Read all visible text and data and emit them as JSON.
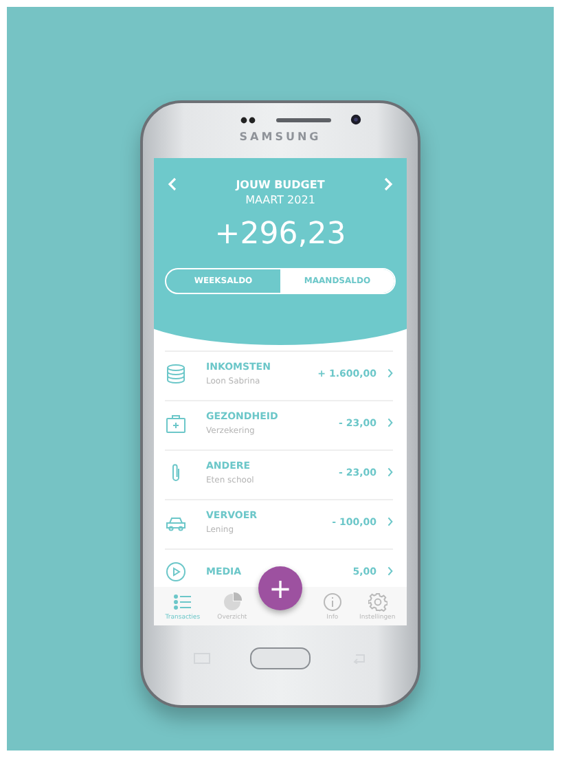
{
  "phone": {
    "brand": "SAMSUNG"
  },
  "header": {
    "title": "JOUW BUDGET",
    "period": "MAART 2021",
    "balance": "+296,23"
  },
  "toggle": [
    {
      "label": "WEEKSALDO",
      "selected": false
    },
    {
      "label": "MAANDSALDO",
      "selected": true
    }
  ],
  "categories": [
    {
      "kind": "coins",
      "title": "INKOMSTEN",
      "subtitle": "Loon Sabrina",
      "amount": "+ 1.600,00"
    },
    {
      "kind": "health",
      "title": "GEZONDHEID",
      "subtitle": "Verzekering",
      "amount": "- 23,00"
    },
    {
      "kind": "clip",
      "title": "ANDERE",
      "subtitle": "Eten school",
      "amount": "- 23,00"
    },
    {
      "kind": "car",
      "title": "VERVOER",
      "subtitle": "Lening",
      "amount": "- 100,00"
    },
    {
      "kind": "media",
      "title": "MEDIA",
      "amount": "5,00"
    }
  ],
  "tab_bar": [
    {
      "kind": "list",
      "label": "Transacties",
      "selected": true
    },
    {
      "kind": "pie",
      "label": "Overzicht",
      "selected": false
    },
    {
      "kind": "info",
      "label": "Info",
      "selected": false
    },
    {
      "kind": "gear",
      "label": "Instellingen",
      "selected": false
    }
  ],
  "fab": {
    "symbol": "+"
  }
}
